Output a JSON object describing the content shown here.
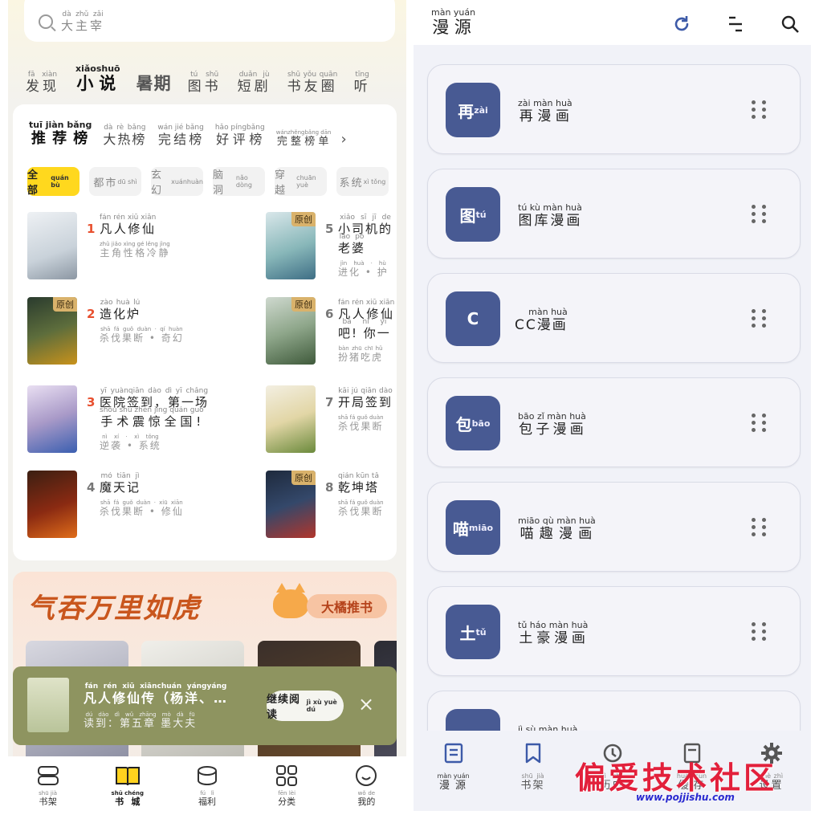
{
  "left": {
    "search": {
      "placeholder": "大主宰",
      "placeholder_py": "dà zhǔ zǎi"
    },
    "top_tabs": [
      {
        "label": "发现",
        "py": "fā xiàn"
      },
      {
        "label": "小说",
        "py": "xiǎoshuō",
        "active": true
      },
      {
        "label": "暑期"
      },
      {
        "label": "图书",
        "py": "tú shū"
      },
      {
        "label": "短剧",
        "py": "duǎn jù"
      },
      {
        "label": "书友圈",
        "py": "shū yǒu quān"
      },
      {
        "label": "听",
        "py": "tīng"
      }
    ],
    "rank_tabs": [
      {
        "label": "推荐榜",
        "py": "tuī jiàn bǎng",
        "active": true
      },
      {
        "label": "大热榜",
        "py": "dà rè bǎng"
      },
      {
        "label": "完结榜",
        "py": "wán jié bǎng"
      },
      {
        "label": "好评榜",
        "py": "hǎo píngbǎng"
      },
      {
        "label": "完整榜单",
        "py": "wánzhěngbǎng dān"
      }
    ],
    "chips": [
      {
        "label": "全部",
        "py": "quán bù",
        "active": true
      },
      {
        "label": "都市",
        "py": "dū shì"
      },
      {
        "label": "玄幻",
        "py": "xuánhuàn"
      },
      {
        "label": "脑洞",
        "py": "nǎo dòng"
      },
      {
        "label": "穿越",
        "py": "chuān yuè"
      },
      {
        "label": "系统",
        "py": "xì tǒng"
      }
    ],
    "books": [
      {
        "rank": "1",
        "title": "凡人修仙",
        "title_py": "fán rén xiū xiān",
        "sub": "主角性格冷静",
        "sub_py": "zhǔ jiǎo xìng gé lěng jìng",
        "badge": ""
      },
      {
        "rank": "2",
        "title": "造化炉",
        "title_py": "zào huà lú",
        "sub": "杀伐果断 • 奇幻",
        "sub_py": "shā fá guǒ duàn · qí huàn",
        "badge": "原创"
      },
      {
        "rank": "3",
        "title": "医院签到，第一场",
        "title2": "手术震惊全国!",
        "title_py": "yī yuànqiān dào dì yī chǎng",
        "title2_py": "shǒu shù zhèn jīng quán guó",
        "sub": "逆袭 • 系统",
        "sub_py": "nì xí · xì tǒng",
        "badge": ""
      },
      {
        "rank": "4",
        "title": "魔天记",
        "title_py": "mó tiān jì",
        "sub": "杀伐果断 • 修仙",
        "sub_py": "shā fá guǒ duàn · xiū xiān",
        "badge": ""
      },
      {
        "rank": "5",
        "title": "小司机的",
        "title2": "老婆",
        "title_py": "xiǎo sī jī de",
        "title2_py": "lǎo pó",
        "sub": "进化 • 护",
        "sub_py": "jìn huà · hù",
        "badge": "原创"
      },
      {
        "rank": "6",
        "title": "凡人修仙",
        "title2": "吧! 你一",
        "title_py": "fán rén xiū xiān",
        "title2_py": "bā nǐ yī",
        "sub": "扮猪吃虎",
        "sub_py": "bàn zhū chī hǔ",
        "badge": "原创"
      },
      {
        "rank": "7",
        "title": "开局签到",
        "title_py": "kāi jú qiān dào",
        "sub": "杀伐果断",
        "sub_py": "shā fá guǒ duàn",
        "badge": ""
      },
      {
        "rank": "8",
        "title": "乾坤塔",
        "title_py": "qián kūn tǎ",
        "sub": "杀伐果断",
        "sub_py": "shā fá guǒ duàn",
        "badge": "原创"
      }
    ],
    "promo": {
      "slogan": "气吞万里如虎",
      "tag": "大橘推书"
    },
    "reading": {
      "title": "凡人修仙传（杨洋、…",
      "title_py": "fán rén xiū xiānchuán yángyáng",
      "progress": "读到：第五章 墨大夫",
      "progress_py": "dú dào dì wǔ zhāng mò dà fū",
      "button": "继续阅读",
      "button_py": "jì xù yuè dú"
    },
    "nav": [
      {
        "label": "书架",
        "py": "shū jià",
        "icon": "bookshelf-icon"
      },
      {
        "label": "书城",
        "py": "shū chéng",
        "icon": "book-open-icon",
        "active": true
      },
      {
        "label": "福利",
        "py": "fú lì",
        "icon": "coin-icon"
      },
      {
        "label": "分类",
        "py": "fēn lèi",
        "icon": "grid-icon"
      },
      {
        "label": "我的",
        "py": "wǒ de",
        "icon": "smile-icon"
      }
    ]
  },
  "right": {
    "title": "漫源",
    "title_py": "màn yuán",
    "sources": [
      {
        "avatar": "再",
        "avatar_py": "zài",
        "name": "再漫画",
        "name_py": "zài màn huà"
      },
      {
        "avatar": "图",
        "avatar_py": "tú",
        "name": "图库漫画",
        "name_py": "tú kù màn huà"
      },
      {
        "avatar": "C",
        "avatar_py": "",
        "name": "CC漫画",
        "name_py": "màn huà"
      },
      {
        "avatar": "包",
        "avatar_py": "bāo",
        "name": "包子漫画",
        "name_py": "bāo zǐ màn huà"
      },
      {
        "avatar": "喵",
        "avatar_py": "miāo",
        "name": "喵趣漫画",
        "name_py": "miāo qù màn huà"
      },
      {
        "avatar": "土",
        "avatar_py": "tǔ",
        "name": "土豪漫画",
        "name_py": "tǔ háo màn huà"
      },
      {
        "avatar": "",
        "avatar_py": "",
        "name": "",
        "name_py": "jì sù màn huà"
      }
    ],
    "nav": [
      {
        "label": "漫源",
        "py": "màn yuán",
        "icon": "source-doc-icon",
        "active": true
      },
      {
        "label": "书架",
        "py": "shū jià",
        "icon": "bookmark-icon"
      },
      {
        "label": "历史",
        "py": "lì shǐ",
        "icon": "history-icon"
      },
      {
        "label": "缓存",
        "py": "huǎn cún",
        "icon": "cache-doc-icon"
      },
      {
        "label": "设置",
        "py": "shè zhì",
        "icon": "gear-icon"
      }
    ],
    "colors": {
      "avatar_bg": "#485a93",
      "accent": "#3d5aa8"
    }
  },
  "watermark": {
    "text": "偏爱技术社区",
    "url": "www.pojjishu.com"
  }
}
